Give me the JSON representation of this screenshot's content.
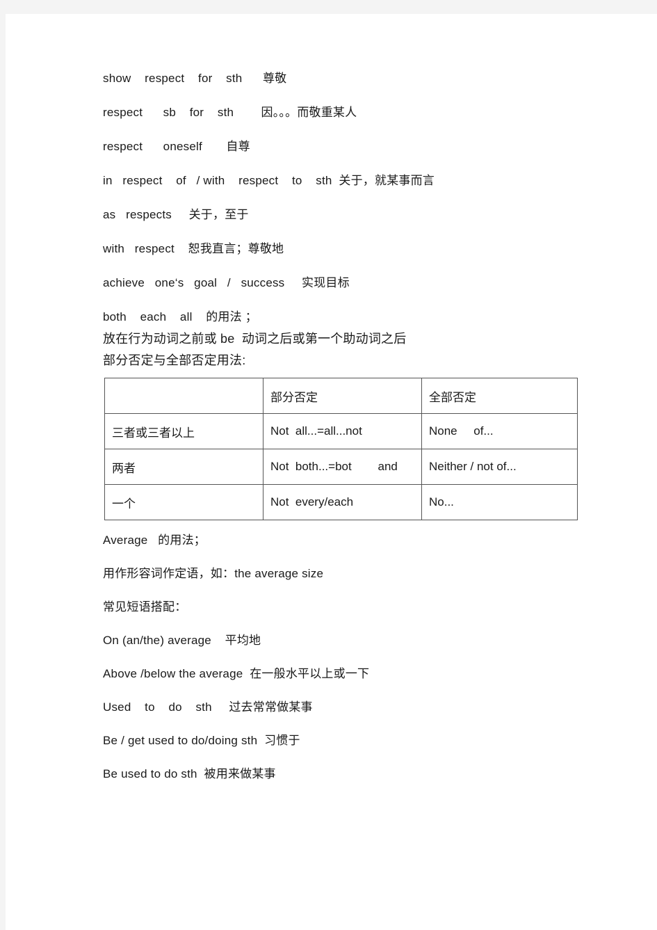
{
  "document": {
    "background_color": "#f4f4f4",
    "page_color": "#ffffff",
    "text_color": "#1a1a1a",
    "border_color": "#555555",
    "lines_top": [
      "show    respect    for    sth      尊敬",
      "respect      sb    for    sth        因。。。而敬重某人",
      "respect      oneself       自尊",
      "in   respect    of   / with    respect    to    sth  关于，就某事而言",
      "as   respects     关于，至于",
      "with   respect    恕我直言；尊敬地",
      "achieve   one‘s   goal   /   success     实现目标",
      "both    each    all    的用法 ；"
    ],
    "lines_tight": [
      "放在行为动词之前或 be  动词之后或第一个助动词之后",
      "部分否定与全部否定用法:"
    ],
    "table": {
      "header": [
        "",
        "部分否定",
        "全部否定"
      ],
      "rows": [
        [
          "三者或三者以上",
          "Not  all...=all...not",
          "None     of..."
        ],
        [
          "两者",
          "Not  both...=bot        and",
          "Neither / not of..."
        ],
        [
          "一个",
          "Not  every/each",
          "No..."
        ]
      ]
    },
    "lines_after_table": [
      "Average   的用法；",
      "用作形容词作定语，如：the average size",
      "常见短语搭配："
    ],
    "lines_tail": [
      "On (an/the) average    平均地",
      "Above /below the average  在一般水平以上或一下",
      "Used    to    do    sth     过去常常做某事",
      "Be / get used to do/doing sth  习惯于",
      "Be used to do sth  被用来做某事"
    ]
  }
}
